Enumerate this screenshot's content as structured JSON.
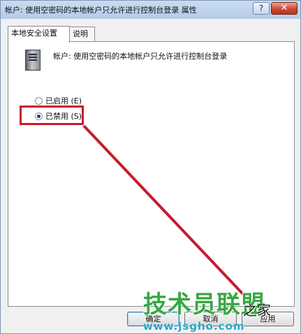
{
  "window": {
    "title": "帐户: 使用空密码的本地帐户只允许进行控制台登录 属性",
    "help_glyph": "?",
    "close_glyph": "✕"
  },
  "tabs": [
    {
      "label": "本地安全设置",
      "active": true
    },
    {
      "label": "说明",
      "active": false
    }
  ],
  "policy": {
    "icon": "server-icon",
    "name": "帐户: 使用空密码的本地帐户只允许进行控制台登录"
  },
  "options": [
    {
      "label": "已启用 (E)",
      "checked": false
    },
    {
      "label": "已禁用 (S)",
      "checked": true
    }
  ],
  "annotation": {
    "color": "#c61b2e"
  },
  "buttons": {
    "ok": "确定",
    "cancel": "取消",
    "apply": "应用"
  },
  "watermark": {
    "main": "技术员联盟",
    "suffix": "之家",
    "url": "www.jsgho.com"
  }
}
